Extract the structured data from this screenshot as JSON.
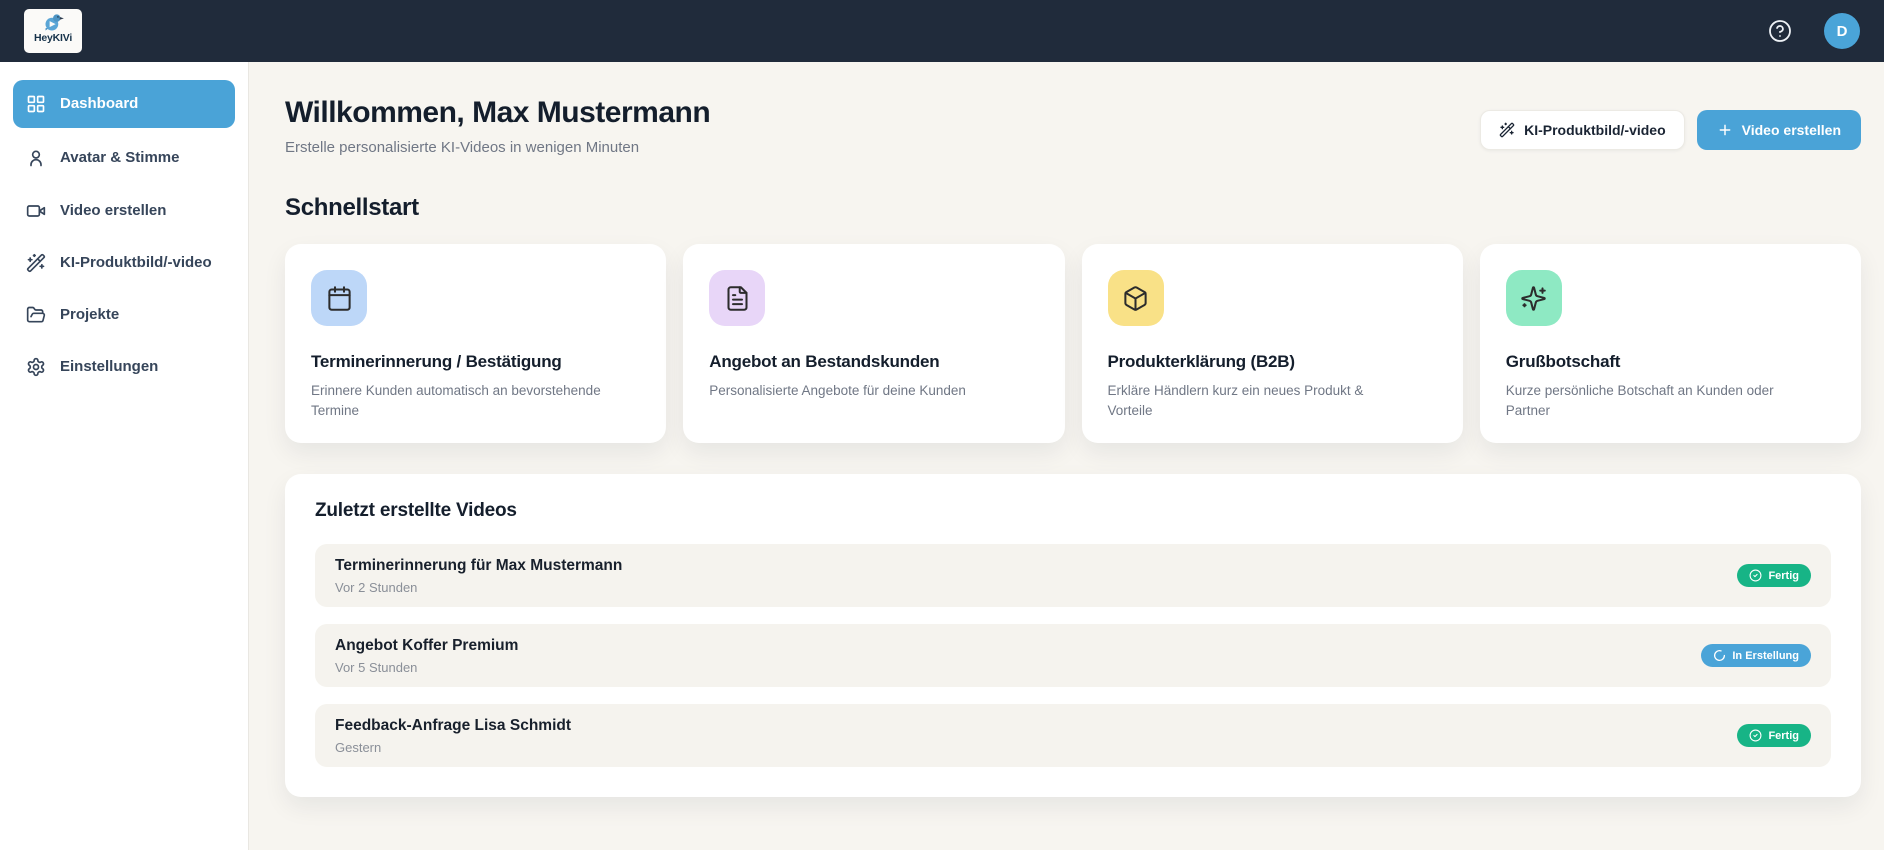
{
  "topbar": {
    "brand": "HeyKIVi",
    "avatar_initial": "D"
  },
  "sidebar": {
    "items": [
      {
        "label": "Dashboard",
        "icon": "dashboard-grid",
        "active": true
      },
      {
        "label": "Avatar & Stimme",
        "icon": "person",
        "active": false
      },
      {
        "label": "Video erstellen",
        "icon": "video-camera",
        "active": false
      },
      {
        "label": "KI-Produktbild/-video",
        "icon": "magic-wand",
        "active": false
      },
      {
        "label": "Projekte",
        "icon": "folder",
        "active": false
      },
      {
        "label": "Einstellungen",
        "icon": "gear",
        "active": false
      }
    ]
  },
  "header": {
    "title": "Willkommen, Max Mustermann",
    "subtitle": "Erstelle personalisierte KI-Videos in wenigen Minuten",
    "product_button": "KI-Produktbild/-video",
    "create_button": "Video erstellen",
    "create_button_plus": "+"
  },
  "quickstart": {
    "title": "Schnellstart",
    "cards": [
      {
        "title": "Terminerinnerung / Bestätigung",
        "description": "Erinnere Kunden automatisch an bevorstehende Termine",
        "icon": "calendar",
        "icon_bg": "#bdd7f8"
      },
      {
        "title": "Angebot an Bestandskunden",
        "description": "Personalisierte Angebote für deine Kunden",
        "icon": "file-text",
        "icon_bg": "#e8d6f8"
      },
      {
        "title": "Produkterklärung (B2B)",
        "description": "Erkläre Händlern kurz ein neues Produkt & Vorteile",
        "icon": "package",
        "icon_bg": "#f9e187"
      },
      {
        "title": "Grußbotschaft",
        "description": "Kurze persönliche Botschaft an Kunden oder Partner",
        "icon": "sparkles",
        "icon_bg": "#8ee9c3"
      }
    ]
  },
  "videos": {
    "title": "Zuletzt erstellte Videos",
    "items": [
      {
        "title": "Terminerinnerung für Max Mustermann",
        "time": "Vor 2 Stunden",
        "status": "Fertig",
        "status_type": "done"
      },
      {
        "title": "Angebot Koffer Premium",
        "time": "Vor 5 Stunden",
        "status": "In Erstellung",
        "status_type": "progress"
      },
      {
        "title": "Feedback-Anfrage Lisa Schmidt",
        "time": "Gestern",
        "status": "Fertig",
        "status_type": "done"
      }
    ]
  },
  "colors": {
    "accent": "#4aa3d7",
    "topbar_bg": "#202b3b",
    "page_bg": "#f7f5f0",
    "badge_done": "#17b486",
    "badge_progress": "#4aa4d8"
  }
}
